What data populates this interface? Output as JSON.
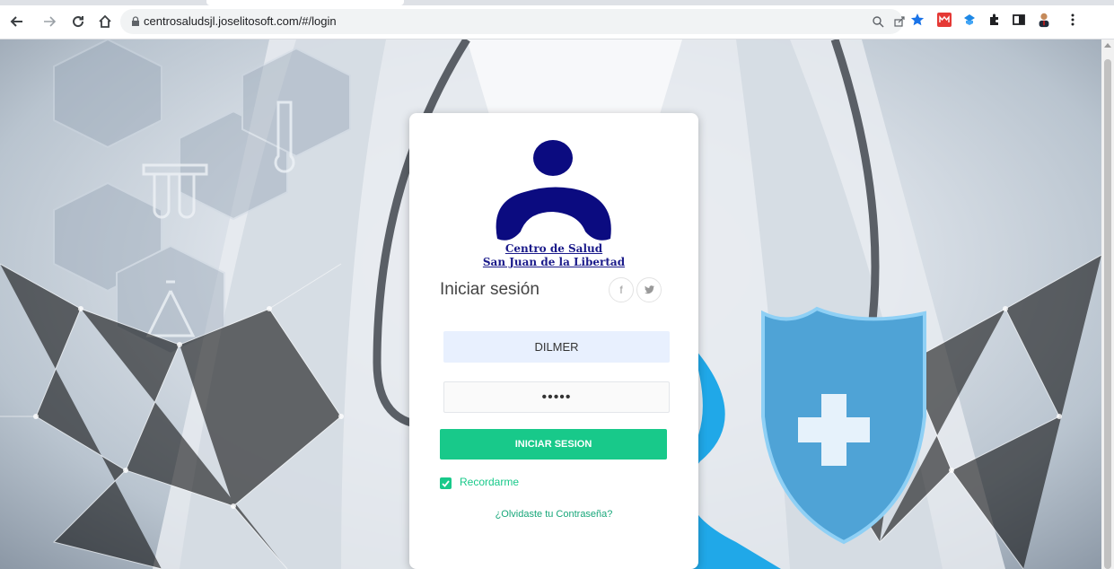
{
  "browser": {
    "url": "centrosaludsjl.joselitosoft.com/#/login"
  },
  "brand": {
    "line1": "Centro de Salud",
    "line2": "San Juan de la Libertad",
    "logo_color": "#0b0b80"
  },
  "login": {
    "title": "Iniciar sesión",
    "social": [
      {
        "name": "facebook",
        "label": "f"
      },
      {
        "name": "twitter",
        "label": "𝕥"
      }
    ],
    "username_value": "DILMER",
    "password_value": "•••••",
    "submit_label": "INICIAR SESION",
    "remember_label": "Recordarme",
    "remember_checked": true,
    "forgot_label": "¿Olvidaste tu Contraseña?"
  },
  "colors": {
    "accent": "#18c98a",
    "autofill": "#e8f0fe"
  }
}
